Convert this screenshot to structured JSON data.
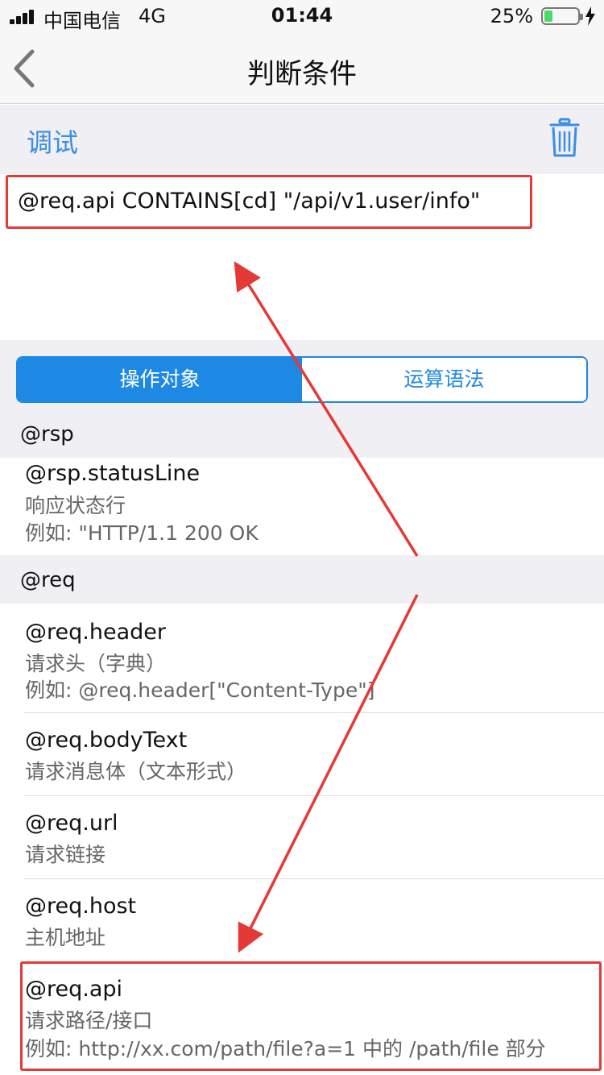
{
  "status_bar": {
    "carrier": "中国电信",
    "network": "4G",
    "time": "01:44",
    "battery_percent": "25%",
    "battery_level": 0.25,
    "battery_color": "#4cd964"
  },
  "nav": {
    "back_icon": "chevron-left-icon",
    "title": "判断条件"
  },
  "toolbar": {
    "debug_label": "调试",
    "trash_icon": "trash-icon"
  },
  "expression": {
    "value": "@req.api CONTAINS[cd] \"/api/v1.user/info\""
  },
  "segment": {
    "tabs": [
      {
        "label": "操作对象",
        "selected": true
      },
      {
        "label": "运算语法",
        "selected": false
      }
    ],
    "accent_color": "#1e88e5"
  },
  "sections": [
    {
      "header": "@rsp",
      "items": [
        {
          "title": "@rsp.statusLine",
          "desc": "响应状态行",
          "example": "例如: \"HTTP/1.1 200 OK"
        }
      ]
    },
    {
      "header": "@req",
      "items": [
        {
          "title": "@req.header",
          "desc": "请求头（字典）",
          "example": "例如: @req.header[\"Content-Type\"]"
        },
        {
          "title": "@req.bodyText",
          "desc": "请求消息体（文本形式）"
        },
        {
          "title": "@req.url",
          "desc": "请求链接"
        },
        {
          "title": "@req.host",
          "desc": "主机地址"
        },
        {
          "title": "@req.api",
          "desc": "请求路径/接口",
          "example": "例如: http://xx.com/path/file?a=1 中的 /path/file 部分"
        }
      ]
    }
  ],
  "annotation_color": "#e53935"
}
